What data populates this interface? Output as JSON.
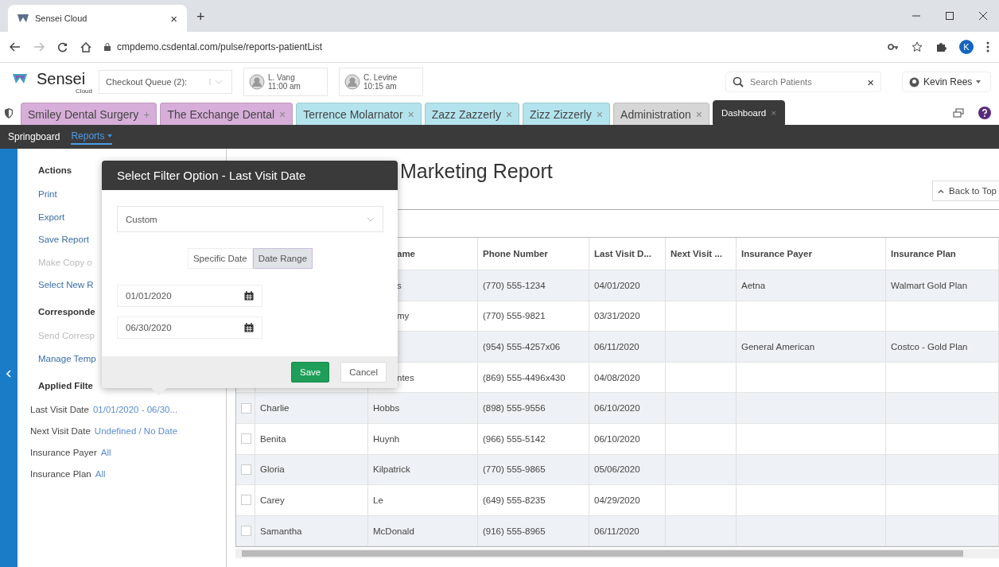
{
  "browser": {
    "tab_title": "Sensei Cloud",
    "tab_close": "×",
    "new_tab": "+",
    "url": "cmpdemo.csdental.com/pulse/reports-patientList",
    "profile_initial": "K"
  },
  "header": {
    "logo_name": "Sensei",
    "logo_sub": "Cloud",
    "queue_label": "Checkout Queue (2):",
    "appointments": [
      {
        "name": "L. Vang",
        "time": "11:00 am"
      },
      {
        "name": "C. Levine",
        "time": "10:15 am"
      }
    ],
    "search": {
      "placeholder": "Search Patients",
      "clear": "×"
    },
    "user": "Kevin Rees"
  },
  "tabs": [
    {
      "label": "Smiley Dental Surgery",
      "close": "+",
      "color": "#d7aed9",
      "selected": false
    },
    {
      "label": "The Exchange Dental",
      "close": "×",
      "color": "#d7aed9",
      "selected": false
    },
    {
      "label": "Terrence Molarnator",
      "close": "×",
      "color": "#b3e4ee",
      "selected": false
    },
    {
      "label": "Zazz Zazzerly",
      "close": "×",
      "color": "#b3e4ee",
      "selected": false
    },
    {
      "label": "Zizz Zizzerly",
      "close": "×",
      "color": "#b3e4ee",
      "selected": false
    },
    {
      "label": "Administration",
      "close": "×",
      "color": "#d6d6d6",
      "selected": false
    },
    {
      "label": "Dashboard",
      "close": "×",
      "color": "#3a3a3a",
      "selected": true
    }
  ],
  "nav": [
    {
      "label": "Springboard",
      "selected": false
    },
    {
      "label": "Reports",
      "selected": true
    }
  ],
  "sidebar": {
    "sections": [
      {
        "title": "Actions",
        "items": [
          {
            "label": "Print",
            "disabled": false
          },
          {
            "label": "Export",
            "disabled": false
          },
          {
            "label": "Save Report",
            "disabled": false
          },
          {
            "label": "Make Copy o",
            "disabled": true
          },
          {
            "label": "Select New R",
            "disabled": false
          }
        ]
      },
      {
        "title": "Corresponde",
        "items": [
          {
            "label": "Send Corresp",
            "disabled": true
          },
          {
            "label": "Manage Temp",
            "disabled": false
          }
        ]
      },
      {
        "title": "Applied Filte"
      }
    ],
    "filters": [
      {
        "label": "Last Visit Date",
        "value": "01/01/2020 - 06/30..."
      },
      {
        "label": "Next Visit Date",
        "value": "Undefined / No Date"
      },
      {
        "label": "Insurance Payer",
        "value": "All"
      },
      {
        "label": "Insurance Plan",
        "value": "All"
      }
    ]
  },
  "report": {
    "title": "Marketing Report",
    "back_to_top": "Back to Top",
    "columns": [
      "ame",
      "Phone Number",
      "Last Visit D...",
      "Next Visit ...",
      "Insurance Payer",
      "Insurance Plan"
    ],
    "rows": [
      {
        "last": "s",
        "phone": "(770) 555-1234",
        "last_visit": "04/01/2020",
        "payer": "Aetna",
        "plan": "Walmart Gold Plan"
      },
      {
        "last": "my",
        "phone": "(770) 555-9821",
        "last_visit": "03/31/2020"
      },
      {
        "phone": "(954) 555-4257x06",
        "last_visit": "06/11/2020",
        "payer": "General American",
        "plan": "Costco - Gold Plan"
      },
      {
        "last": "ntes",
        "phone": "(869) 555-4496x430",
        "last_visit": "04/08/2020"
      },
      {
        "first": "Charlie",
        "last": "Hobbs",
        "phone": "(898) 555-9556",
        "last_visit": "06/10/2020",
        "checked": false
      },
      {
        "first": "Benita",
        "last": "Huynh",
        "phone": "(966) 555-5142",
        "last_visit": "06/10/2020",
        "checked": false
      },
      {
        "first": "Gloria",
        "last": "Kilpatrick",
        "phone": "(770) 555-9865",
        "last_visit": "05/06/2020",
        "checked": false
      },
      {
        "first": "Carey",
        "last": "Le",
        "phone": "(649) 555-8235",
        "last_visit": "04/29/2020",
        "checked": false
      },
      {
        "first": "Samantha",
        "last": "McDonald",
        "phone": "(916) 555-8965",
        "last_visit": "06/11/2020",
        "checked": false
      }
    ]
  },
  "dialog": {
    "title": "Select Filter Option - Last Visit Date",
    "option": "Custom",
    "modes": [
      {
        "label": "Specific Date",
        "selected": false
      },
      {
        "label": "Date Range",
        "selected": true
      }
    ],
    "dates": [
      "01/01/2020",
      "06/30/2020"
    ],
    "save": "Save",
    "cancel": "Cancel"
  }
}
